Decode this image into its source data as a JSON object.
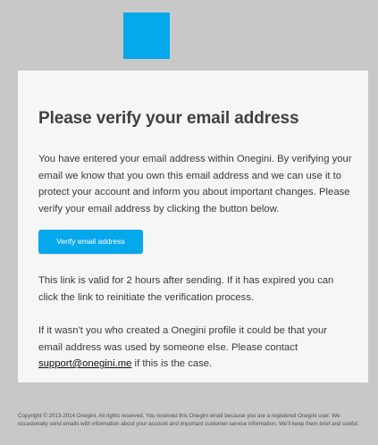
{
  "brand": {
    "color": "#06a8ec",
    "logo_icon": "blue-square-logo"
  },
  "email": {
    "title": "Please verify your email address",
    "intro": "You have entered your email address within Onegini. By verifying your email we know that you own this email address and we can use it to protect your account and inform you about important changes. Please verify your email address by clicking the button below.",
    "verify_button_label": "Verify email address",
    "validity": "This link is valid for 2 hours after sending. If it has expired you can click the link to reinitiate the verification process.",
    "contact_before": "If it wasn't you who created a Onegini profile it could be that your email address was used by someone else. Please contact ",
    "contact_link": "support@onegini.me",
    "contact_after": " if this is the case."
  },
  "footer": {
    "text": "Copyright © 2013-2014 Onegini, All rights reserved. You received this Onegini email because you are a registered Onegini user. We occasionally send emails with information about your account and important customer-service information. We'll keep them brief and useful."
  },
  "colors": {
    "page_background": "#c8c8c8",
    "card_background": "#f6f6f6",
    "accent": "#06a8ec"
  }
}
